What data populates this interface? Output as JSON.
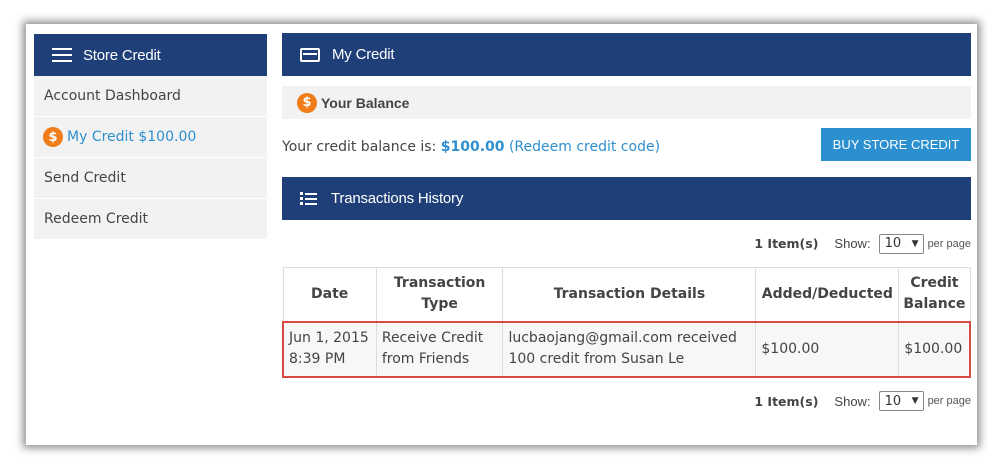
{
  "sidebar": {
    "title": "Store Credit",
    "items": [
      {
        "label": "Account Dashboard"
      },
      {
        "label": "My Credit $100.00",
        "icon": "dollar-coin-icon"
      },
      {
        "label": "Send Credit"
      },
      {
        "label": "Redeem Credit"
      }
    ]
  },
  "main": {
    "title": "My Credit",
    "balance_section_title": "Your Balance",
    "balance_text_prefix": "Your credit balance is: ",
    "balance_amount": "$100.00",
    "redeem_link": "(Redeem credit code)",
    "buy_button": "BUY STORE CREDIT",
    "history_title": "Transactions History",
    "pager": {
      "count": "1 Item(s)",
      "show_label": "Show:",
      "per_page_value": "10",
      "per_page_label": "per page"
    },
    "table": {
      "headers": [
        "Date",
        "Transaction Type",
        "Transaction Details",
        "Added/Deducted",
        "Credit Balance"
      ],
      "rows": [
        [
          "Jun 1, 2015 8:39 PM",
          "Receive Credit from Friends",
          "lucbaojang@gmail.com received 100 credit from Susan Le",
          "$100.00",
          "$100.00"
        ]
      ]
    }
  },
  "colors": {
    "header_bg": "#1f3f78",
    "accent": "#2f8fcf",
    "button_bg": "#2b8fd0",
    "coin": "#f07d1a",
    "highlight_border": "#d94a43"
  }
}
